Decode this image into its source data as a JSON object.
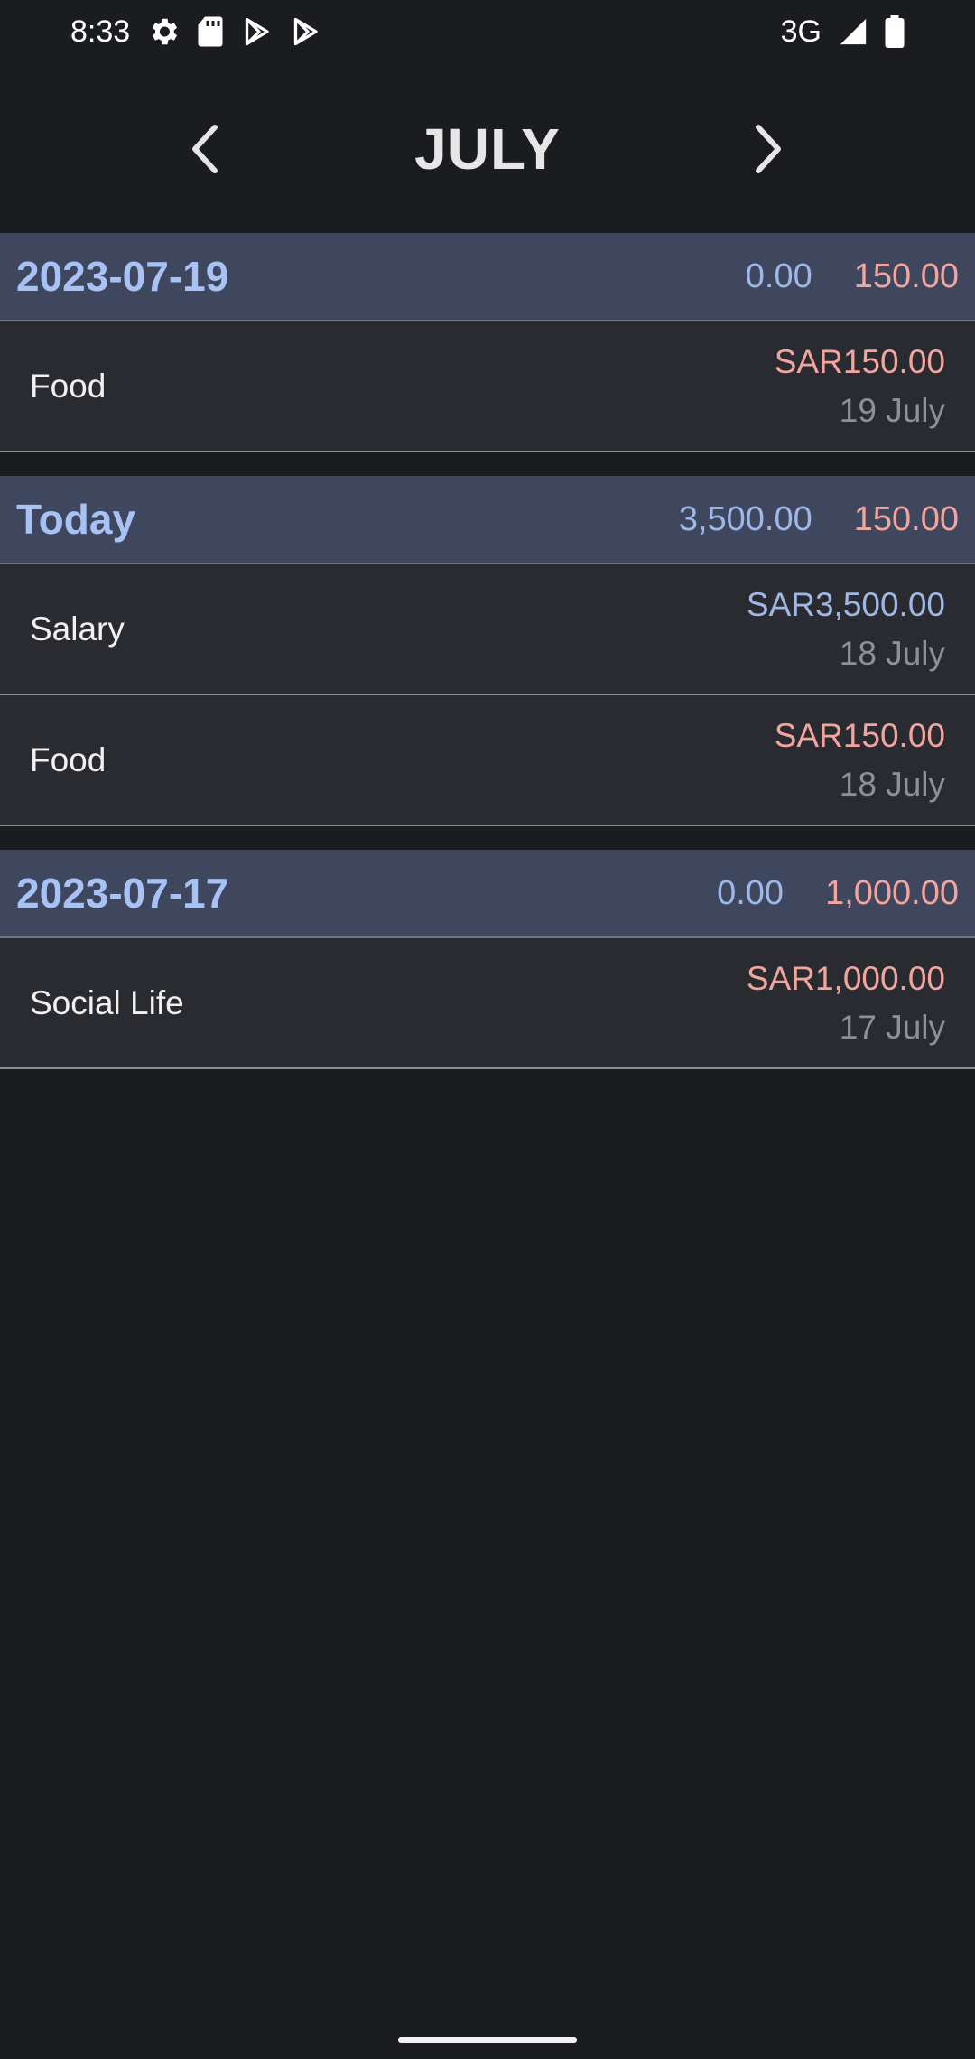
{
  "status_bar": {
    "time": "8:33",
    "network": "3G",
    "icons_left": [
      "settings-gear-icon",
      "sd-card-icon",
      "play-store-icon",
      "play-store-icon"
    ],
    "icons_right": [
      "signal-icon",
      "battery-icon"
    ]
  },
  "header": {
    "month": "JULY",
    "prev_icon": "chevron-left-icon",
    "next_icon": "chevron-right-icon"
  },
  "groups": [
    {
      "date": "2023-07-19",
      "income_total": "0.00",
      "expense_total": "150.00",
      "transactions": [
        {
          "category": "Food",
          "amount": "SAR150.00",
          "type": "expense",
          "date": "19 July"
        }
      ]
    },
    {
      "date": "Today",
      "income_total": "3,500.00",
      "expense_total": "150.00",
      "transactions": [
        {
          "category": "Salary",
          "amount": "SAR3,500.00",
          "type": "income",
          "date": "18 July"
        },
        {
          "category": "Food",
          "amount": "SAR150.00",
          "type": "expense",
          "date": "18 July"
        }
      ]
    },
    {
      "date": "2023-07-17",
      "income_total": "0.00",
      "expense_total": "1,000.00",
      "transactions": [
        {
          "category": "Social Life",
          "amount": "SAR1,000.00",
          "type": "expense",
          "date": "17 July"
        }
      ]
    }
  ],
  "colors": {
    "background": "#1b1c20",
    "group_header": "#3e475e",
    "row": "#2a2b30",
    "date_text": "#a9c2f5",
    "income": "#9fb7e6",
    "expense": "#f2a59e",
    "muted": "#8d9096"
  }
}
